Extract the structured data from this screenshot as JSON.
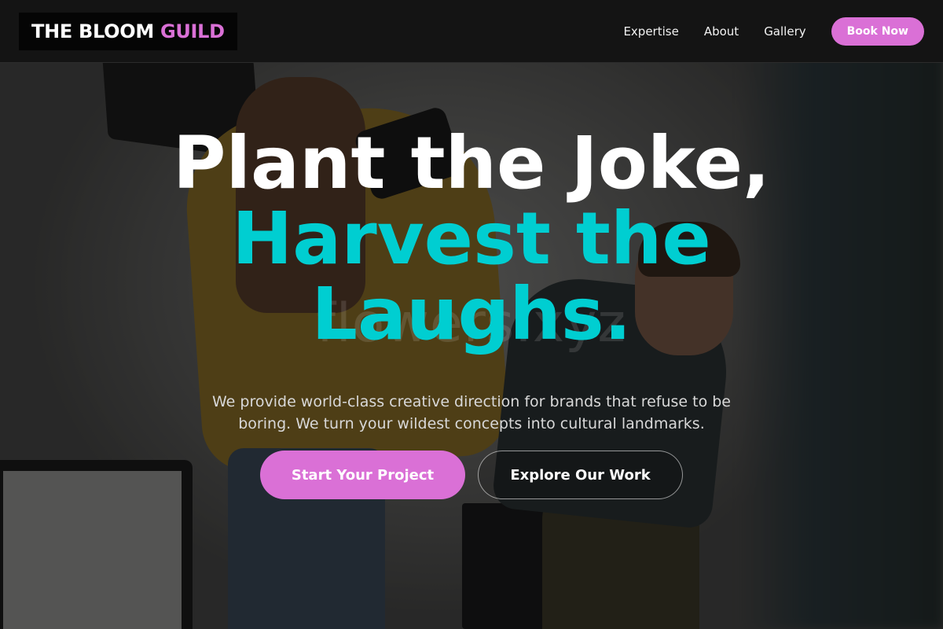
{
  "brand": {
    "name_primary": "THE BLOOM",
    "name_accent": "GUILD"
  },
  "nav": {
    "links": [
      {
        "label": "Expertise"
      },
      {
        "label": "About"
      },
      {
        "label": "Gallery"
      }
    ],
    "cta_label": "Book Now"
  },
  "hero": {
    "headline_line1": "Plant the Joke,",
    "headline_line2": "Harvest the Laughs.",
    "watermark": "flowers.xyz",
    "subtext": "We provide world-class creative direction for brands that refuse to be boring. We turn your wildest concepts into cultural landmarks.",
    "primary_cta": "Start Your Project",
    "secondary_cta": "Explore Our Work"
  },
  "colors": {
    "accent": "#da70d6",
    "highlight": "#00ced1",
    "nav_bg": "#141414"
  }
}
